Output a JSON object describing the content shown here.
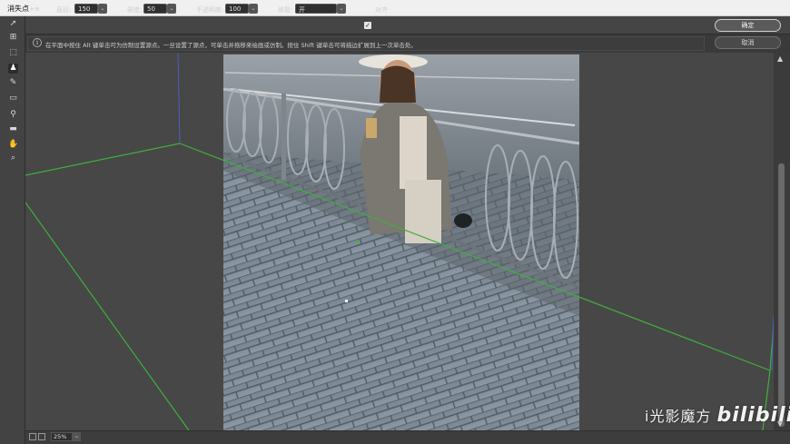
{
  "window": {
    "title": "消失点"
  },
  "toolbar": {
    "mode_label": "+≡",
    "diameter_label": "直径:",
    "diameter_value": "150",
    "hardness_label": "硬度:",
    "hardness_value": "50",
    "opacity_label": "不透明度:",
    "opacity_value": "100",
    "heal_label": "修复:",
    "heal_value": "开",
    "align_label": "对齐",
    "align_checked": true
  },
  "info": {
    "text": "在平面中按住 Alt 键单击可为仿制设置源点。一旦设置了源点，可单击并拖移来绘画或仿制。按住 Shift 键单击可将描边扩展到上一次单击处。"
  },
  "buttons": {
    "ok": "确定",
    "cancel": "取消"
  },
  "tools": [
    {
      "name": "edit-plane-tool",
      "icon": "arrow-icon"
    },
    {
      "name": "create-plane-tool",
      "icon": "grid-icon"
    },
    {
      "name": "marquee-tool",
      "icon": "marquee-icon"
    },
    {
      "name": "stamp-tool",
      "icon": "stamp-icon",
      "active": true
    },
    {
      "name": "brush-tool",
      "icon": "brush-icon"
    },
    {
      "name": "transform-tool",
      "icon": "transform-icon"
    },
    {
      "name": "eyedropper-tool",
      "icon": "eyedropper-icon"
    },
    {
      "name": "measure-tool",
      "icon": "ruler-icon"
    },
    {
      "name": "hand-tool",
      "icon": "hand-icon"
    },
    {
      "name": "zoom-tool",
      "icon": "magnifier-icon"
    }
  ],
  "status": {
    "zoom": "25%"
  },
  "watermark": {
    "text": "i光影魔方",
    "logo": "bilibili"
  },
  "colors": {
    "plane_grid": "#3fae3f",
    "perspective_blue": "#4d5fc4"
  }
}
